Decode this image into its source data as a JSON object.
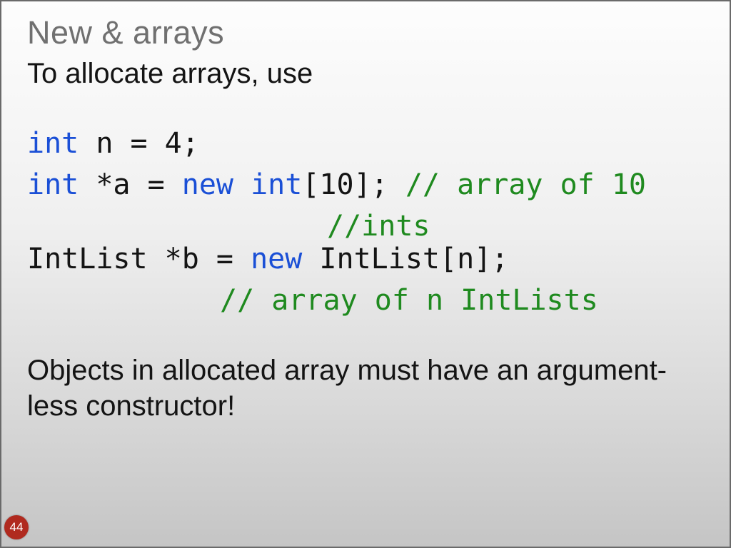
{
  "title": "New & arrays",
  "intro": "To allocate arrays, use",
  "code": {
    "line1": {
      "kw": "int",
      "rest": " n = 4;"
    },
    "line2": {
      "kw1": "int",
      "mid1": " *a = ",
      "kw2": "new",
      "mid2": " ",
      "kw3": "int",
      "rest": "[10]; ",
      "cmt": "// array of 10"
    },
    "line3": {
      "cmt": "//ints"
    },
    "line4": {
      "pre": "IntList *b = ",
      "kw": "new",
      "post": " IntList[n];"
    },
    "line5": {
      "cmt": "// array of n IntLists"
    }
  },
  "outro": "Objects in allocated array must have an argument-less constructor!",
  "page": "44"
}
